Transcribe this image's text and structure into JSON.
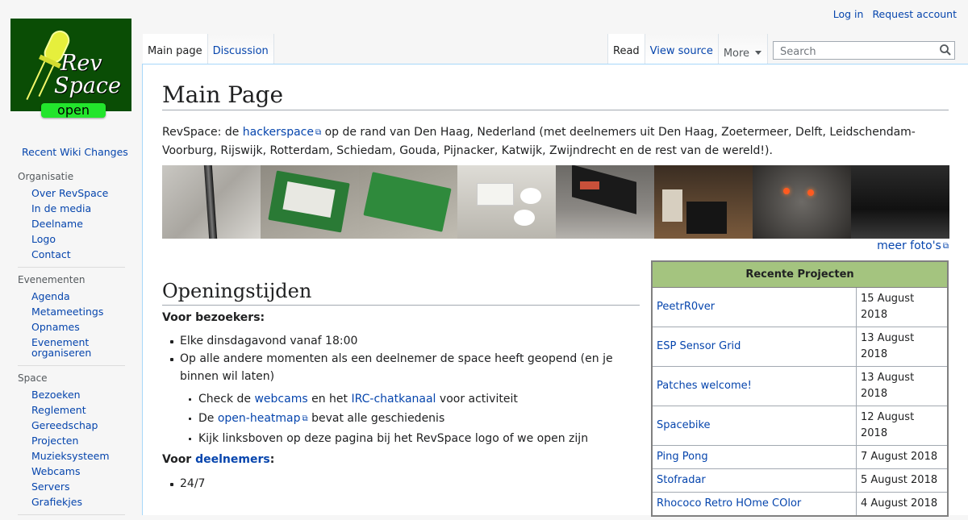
{
  "logo": {
    "line1": "Rev",
    "line2": "Space",
    "status": "open"
  },
  "personal": {
    "login": "Log in",
    "request": "Request account"
  },
  "tabs_left": [
    "Main page",
    "Discussion"
  ],
  "tabs_right": {
    "read": "Read",
    "view_source": "View source",
    "more": "More"
  },
  "search": {
    "placeholder": "Search"
  },
  "sidebar": {
    "recent": "Recent Wiki Changes",
    "sections": [
      {
        "heading": "Organisatie",
        "items": [
          "Over RevSpace",
          "In de media",
          "Deelname",
          "Logo",
          "Contact"
        ]
      },
      {
        "heading": "Evenementen",
        "items": [
          "Agenda",
          "Metameetings",
          "Opnames",
          "Evenement organiseren"
        ]
      },
      {
        "heading": "Space",
        "items": [
          "Bezoeken",
          "Reglement",
          "Gereedschap",
          "Projecten",
          "Muzieksysteem",
          "Webcams",
          "Servers",
          "Grafiekjes"
        ]
      }
    ]
  },
  "page": {
    "title": "Main Page",
    "intro_pre": "RevSpace: de ",
    "intro_link": "hackerspace",
    "intro_post": " op de rand van Den Haag, Nederland (met deelnemers uit Den Haag, Zoetermeer, Delft, Leidschendam-Voorburg, Rijswijk, Rotterdam, Schiedam, Gouda, Pijnacker, Katwijk, Zwijndrecht en de rest van de wereld!).",
    "more_photos": "meer foto's",
    "section_title": "Openingstijden",
    "visitors_heading": "Voor bezoekers:",
    "visitors_items": [
      "Elke dinsdagavond vanaf 18:00",
      "Op alle andere momenten als een deelnemer de space heeft geopend (en je binnen wil laten)"
    ],
    "sub": {
      "a_pre": "Check de ",
      "a_link1": "webcams",
      "a_mid": " en het ",
      "a_link2": "IRC-chatkanaal",
      "a_post": " voor activiteit",
      "b_pre": "De ",
      "b_link": "open-heatmap",
      "b_post": " bevat alle geschiedenis",
      "c": "Kijk linksboven op deze pagina bij het RevSpace logo of we open zijn"
    },
    "members_pre": "Voor ",
    "members_link": "deelnemers",
    "members_post": ":",
    "members_items": [
      "24/7"
    ]
  },
  "projects": {
    "heading": "Recente Projecten",
    "rows": [
      {
        "name": "PeetrR0ver",
        "date": "15 August 2018"
      },
      {
        "name": "ESP Sensor Grid",
        "date": "13 August 2018"
      },
      {
        "name": "Patches welcome!",
        "date": "13 August 2018"
      },
      {
        "name": "Spacebike",
        "date": "12 August 2018"
      },
      {
        "name": "Ping Pong",
        "date": "7 August 2018"
      },
      {
        "name": "Stofradar",
        "date": "5 August 2018"
      },
      {
        "name": "Rhococo Retro HOme COlor",
        "date": "4 August 2018"
      }
    ]
  },
  "colors": {
    "link": "#0645ad",
    "logo_bg": "#0a4d05",
    "open_badge": "#22e52c",
    "table_header": "#a4c47f"
  }
}
